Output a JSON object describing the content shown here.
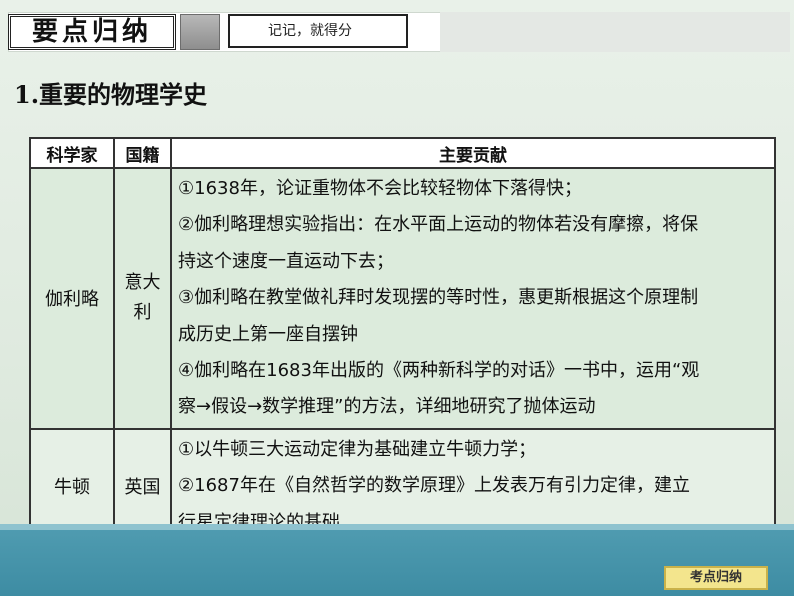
{
  "header": {
    "title": "要点归纳",
    "tagline": "记记，就得分"
  },
  "section_heading": "1.重要的物理学史",
  "table": {
    "columns": [
      "科学家",
      "国籍",
      "主要贡献"
    ],
    "rows": [
      {
        "scientist": "伽利略",
        "nationality": "意大利",
        "contributions": [
          "①1638年，论证重物体不会比较轻物体下落得快；",
          "②伽利略理想实验指出：在水平面上运动的物体若没有摩擦，将保",
          "持这个速度一直运动下去；",
          "③伽利略在教堂做礼拜时发现摆的等时性，惠更斯根据这个原理制",
          "成历史上第一座自摆钟",
          "④伽利略在1683年出版的《两种新科学的对话》一书中，运用“观",
          "察→假设→数学推理”的方法，详细地研究了抛体运动"
        ]
      },
      {
        "scientist": "牛顿",
        "nationality": "英国",
        "contributions": [
          "①以牛顿三大运动定律为基础建立牛顿力学；",
          "②1687年在《自然哲学的数学原理》上发表万有引力定律，建立",
          "行星定律理论的基础"
        ]
      }
    ]
  },
  "footer": {
    "tag": "考点归纳"
  },
  "colors": {
    "background": "#e2ede2",
    "footer_band": "#4f9bb0",
    "footer_tag": "#f3e58d"
  }
}
